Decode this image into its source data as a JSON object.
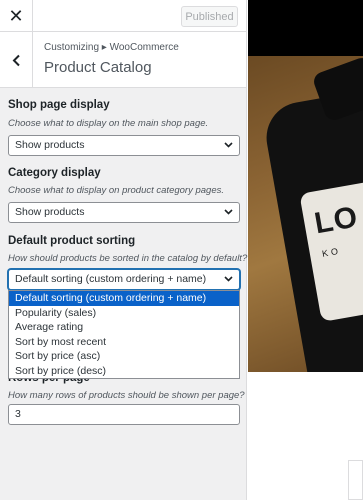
{
  "topbar": {
    "close_glyph": "✕",
    "publish_label": "Published"
  },
  "section": {
    "breadcrumb": "Customizing ▸ WooCommerce",
    "title": "Product Catalog"
  },
  "controls": {
    "shop_display": {
      "label": "Shop page display",
      "description": "Choose what to display on the main shop page.",
      "value": "Show products"
    },
    "category_display": {
      "label": "Category display",
      "description": "Choose what to display on product category pages.",
      "value": "Show products"
    },
    "default_sorting": {
      "label": "Default product sorting",
      "description": "How should products be sorted in the catalog by default?",
      "value": "Default sorting (custom ordering + name)",
      "options": [
        "Default sorting (custom ordering + name)",
        "Popularity (sales)",
        "Average rating",
        "Sort by most recent",
        "Sort by price (asc)",
        "Sort by price (desc)"
      ]
    },
    "rows_per_page": {
      "label": "Rows per page",
      "description": "How many rows of products should be shown per page?",
      "value": "3"
    }
  },
  "preview": {
    "label_text": "LO",
    "label_sub": "KO"
  },
  "colors": {
    "accent": "#2271b1",
    "selected_option": "#0a62c9"
  },
  "icons": {
    "close": "close-icon",
    "back": "chevron-left-icon",
    "select": "chevron-down-icon"
  }
}
